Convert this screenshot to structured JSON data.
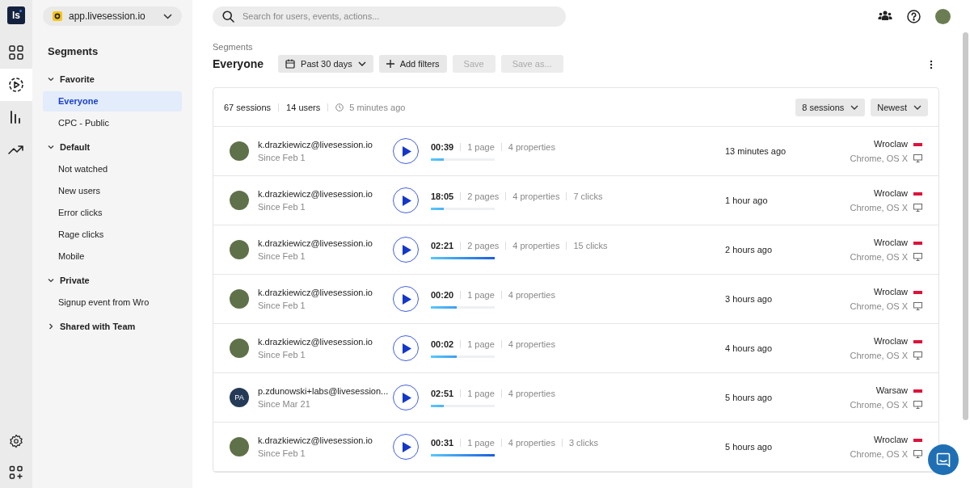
{
  "rail": {
    "logo_text": "ls",
    "items": [
      {
        "selected": false
      },
      {
        "selected": true
      },
      {
        "selected": false
      },
      {
        "selected": false
      }
    ]
  },
  "project": {
    "name": "app.livesession.io"
  },
  "sidebar": {
    "title": "Segments",
    "groups": [
      {
        "label": "Favorite",
        "expanded": true,
        "items": [
          {
            "label": "Everyone",
            "selected": true
          },
          {
            "label": "CPC - Public",
            "selected": false
          }
        ]
      },
      {
        "label": "Default",
        "expanded": true,
        "items": [
          {
            "label": "Not watched",
            "selected": false
          },
          {
            "label": "New users",
            "selected": false
          },
          {
            "label": "Error clicks",
            "selected": false
          },
          {
            "label": "Rage clicks",
            "selected": false
          },
          {
            "label": "Mobile",
            "selected": false
          }
        ]
      },
      {
        "label": "Private",
        "expanded": true,
        "items": [
          {
            "label": "Signup event from Wro",
            "selected": false
          }
        ]
      },
      {
        "label": "Shared with Team",
        "expanded": false
      }
    ]
  },
  "search": {
    "placeholder": "Search for users, events, actions..."
  },
  "header": {
    "breadcrumb": "Segments",
    "title": "Everyone",
    "buttons": [
      {
        "kind": "dropdown",
        "label": "Past 30 days",
        "disabled": false
      },
      {
        "kind": "add",
        "label": "Add filters",
        "disabled": false
      },
      {
        "kind": "plain",
        "label": "Save",
        "disabled": true
      },
      {
        "kind": "plain",
        "label": "Save as...",
        "disabled": true
      }
    ]
  },
  "summary": {
    "sessions": "67 sessions",
    "users": "14 users",
    "updated": "5 minutes ago",
    "limit": "8 sessions",
    "sort": "Newest"
  },
  "sessions": [
    {
      "user": "k.drazkiewicz@livesession.io",
      "since": "Since Feb 1",
      "avatar": {
        "kind": "photo"
      },
      "duration": "00:39",
      "stats": [
        "1 page",
        "4 properties"
      ],
      "level": 0.2,
      "time": "13 minutes ago",
      "city": "Wroclaw",
      "client": "Chrome, OS X"
    },
    {
      "user": "k.drazkiewicz@livesession.io",
      "since": "Since Feb 1",
      "avatar": {
        "kind": "photo"
      },
      "duration": "18:05",
      "stats": [
        "2 pages",
        "4 properties",
        "7 clicks"
      ],
      "level": 0.2,
      "time": "1 hour ago",
      "city": "Wroclaw",
      "client": "Chrome, OS X"
    },
    {
      "user": "k.drazkiewicz@livesession.io",
      "since": "Since Feb 1",
      "avatar": {
        "kind": "photo"
      },
      "duration": "02:21",
      "stats": [
        "2 pages",
        "4 properties",
        "15 clicks"
      ],
      "level": 1,
      "time": "2 hours ago",
      "city": "Wroclaw",
      "client": "Chrome, OS X"
    },
    {
      "user": "k.drazkiewicz@livesession.io",
      "since": "Since Feb 1",
      "avatar": {
        "kind": "photo"
      },
      "duration": "00:20",
      "stats": [
        "1 page",
        "4 properties"
      ],
      "level": 0.4,
      "time": "3 hours ago",
      "city": "Wroclaw",
      "client": "Chrome, OS X"
    },
    {
      "user": "k.drazkiewicz@livesession.io",
      "since": "Since Feb 1",
      "avatar": {
        "kind": "photo"
      },
      "duration": "00:02",
      "stats": [
        "1 page",
        "4 properties"
      ],
      "level": 0.4,
      "time": "4 hours ago",
      "city": "Wroclaw",
      "client": "Chrome, OS X"
    },
    {
      "user": "p.zdunowski+labs@livesession...",
      "since": "Since Mar 21",
      "avatar": {
        "kind": "initials",
        "initials": "PA"
      },
      "duration": "02:51",
      "stats": [
        "1 page",
        "4 properties"
      ],
      "level": 0.2,
      "time": "5 hours ago",
      "city": "Warsaw",
      "client": "Chrome, OS X"
    },
    {
      "user": "k.drazkiewicz@livesession.io",
      "since": "Since Feb 1",
      "avatar": {
        "kind": "photo"
      },
      "duration": "00:31",
      "stats": [
        "1 page",
        "4 properties",
        "3 clicks"
      ],
      "level": 1,
      "time": "5 hours ago",
      "city": "Wroclaw",
      "client": "Chrome, OS X"
    }
  ]
}
